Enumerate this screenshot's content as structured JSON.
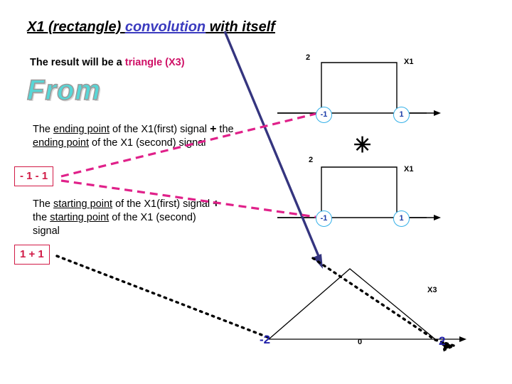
{
  "title": {
    "part1": "X1 (rectangle) ",
    "part2": "convolution",
    "part3": " with itself"
  },
  "subtitle": {
    "lead": "The result will be a ",
    "highlight": "triangle (X3)"
  },
  "wordart": {
    "text": "From"
  },
  "paragraphs": {
    "ending": {
      "l1a": "The ",
      "l1b": "ending point",
      "l1c": " of the X1(first) signal ",
      "l1d": "+",
      "l1e": " the",
      "l2a": "ending point",
      "l2b": " of the X1 (second) signal"
    },
    "starting": {
      "l1a": "The ",
      "l1b": "starting point",
      "l1c": " of the X1(first) signal ",
      "l1d": "+",
      "l2a": "the ",
      "l2b": "starting point",
      "l2c": " of the X1 (second)",
      "l3": "signal"
    }
  },
  "boxes": {
    "ending_result": "- 1 - 1",
    "starting_result": "1 + 1"
  },
  "signal1": {
    "amplitude": "2",
    "name": "X1",
    "left_tick": "-1",
    "right_tick": "1"
  },
  "operator": "✳",
  "signal2": {
    "amplitude": "2",
    "name": "X1",
    "left_tick": "-1",
    "right_tick": "1"
  },
  "result": {
    "name": "X3",
    "left_tick": "-2",
    "center_tick": "0",
    "right_tick": "2"
  },
  "colors": {
    "accent_pink": "#cf1066",
    "title_blue": "#3b3bbf",
    "red_box": "#d11a46",
    "wordart_fill": "#56d7d7",
    "dark_arrow": "#35357f",
    "badge_blue": "#34b0e8"
  }
}
